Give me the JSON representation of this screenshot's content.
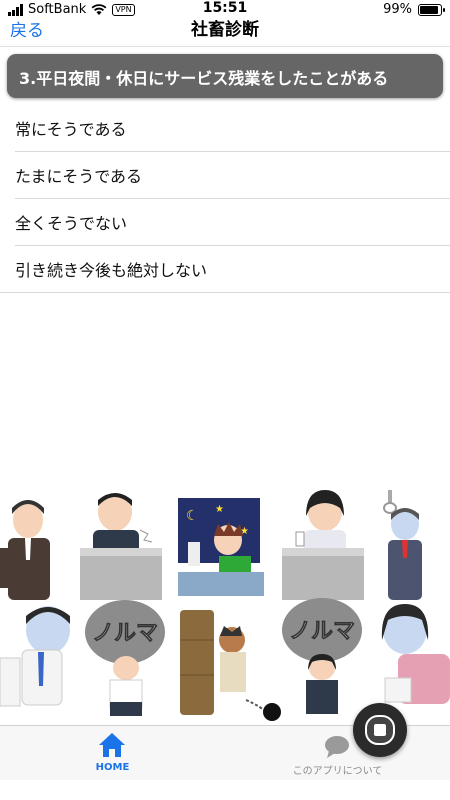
{
  "status_bar": {
    "carrier": "SoftBank",
    "vpn": "VPN",
    "time": "15:51",
    "battery": "99%",
    "battery_level": 0.99
  },
  "nav": {
    "back_label": "戻る",
    "title": "社畜診断"
  },
  "question": {
    "text": "3.平日夜間・休日にサービス残業をしたことがある"
  },
  "options": [
    {
      "label": "常にそうである"
    },
    {
      "label": "たまにそうである"
    },
    {
      "label": "全くそうでない"
    },
    {
      "label": "引き続き今後も絶対しない"
    }
  ],
  "illustration": {
    "boulder_text": "ノルマ"
  },
  "tabs": [
    {
      "label": "HOME",
      "icon": "home-icon",
      "active": true
    },
    {
      "label": "このアプリについて",
      "icon": "chat-bubble-icon",
      "active": false
    }
  ],
  "colors": {
    "accent": "#1a73e8",
    "question_bg": "#666666",
    "inactive": "#8a8a8a"
  }
}
